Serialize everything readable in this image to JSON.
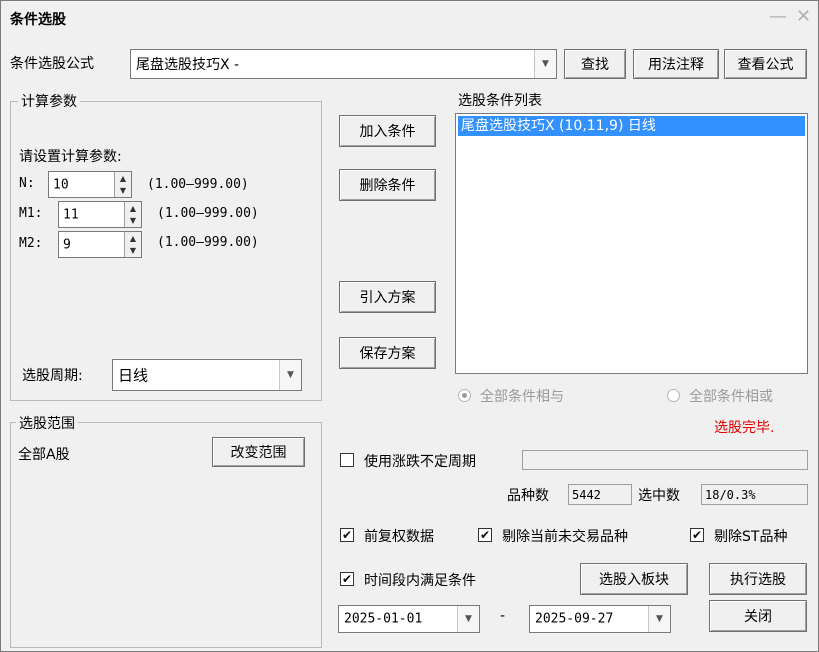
{
  "window": {
    "title": "条件选股"
  },
  "formula": {
    "label": "条件选股公式",
    "value": "尾盘选股技巧X  -",
    "find_button": "查找",
    "usage_button": "用法注释",
    "view_button": "查看公式"
  },
  "params": {
    "group_title": "计算参数",
    "prompt": "请设置计算参数:",
    "rows": [
      {
        "name": "N:",
        "value": "10",
        "range": "(1.00—999.00)"
      },
      {
        "name": "M1:",
        "value": "11",
        "range": "(1.00—999.00)"
      },
      {
        "name": "M2:",
        "value": "9",
        "range": "(1.00—999.00)"
      }
    ],
    "period_label": "选股周期:",
    "period_value": "日线"
  },
  "scope": {
    "group_title": "选股范围",
    "value": "全部A股",
    "change_button": "改变范围"
  },
  "middle_buttons": {
    "add": "加入条件",
    "delete": "删除条件",
    "import": "引入方案",
    "save": "保存方案"
  },
  "conditions": {
    "label": "选股条件列表",
    "items": [
      "尾盘选股技巧X (10,11,9) 日线"
    ]
  },
  "logic": {
    "and_label": "全部条件相与",
    "or_label": "全部条件相或",
    "selected": "and"
  },
  "status": {
    "text": "选股完毕.",
    "color": "#e00000"
  },
  "options": {
    "variable_period_label": "使用涨跌不定周期",
    "variable_period_checked": false,
    "count_label": "品种数",
    "count_value": "5442",
    "selected_label": "选中数",
    "selected_value": "18/0.3%",
    "forward_adjust_label": "前复权数据",
    "exclude_untraded_label": "剔除当前未交易品种",
    "exclude_st_label": "剔除ST品种",
    "time_range_label": "时间段内满足条件"
  },
  "actions": {
    "to_block": "选股入板块",
    "execute": "执行选股",
    "close": "关闭"
  },
  "dates": {
    "start": "2025-01-01",
    "separator": "-",
    "end": "2025-09-27"
  }
}
